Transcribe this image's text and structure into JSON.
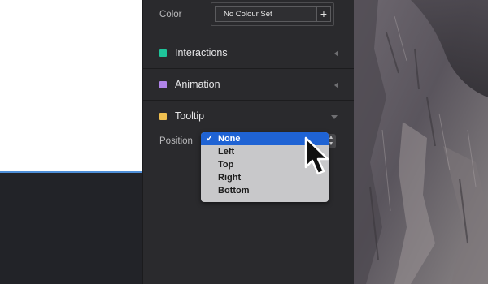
{
  "properties_panel": {
    "color": {
      "label": "Color",
      "value": "No Colour Set",
      "add_symbol": "+"
    },
    "sections": [
      {
        "title": "Interactions",
        "swatch_color": "#1fc49a",
        "expanded": false
      },
      {
        "title": "Animation",
        "swatch_color": "#b084e8",
        "expanded": false
      },
      {
        "title": "Tooltip",
        "swatch_color": "#f0c050",
        "expanded": true
      }
    ],
    "tooltip": {
      "position_label": "Position",
      "dropdown": {
        "options": [
          "None",
          "Left",
          "Top",
          "Right",
          "Bottom"
        ],
        "selected": "None",
        "check_symbol": "✓"
      }
    }
  },
  "colors": {
    "highlight": "#1f63d4",
    "canvas_selection_line": "#4f8fd8"
  }
}
